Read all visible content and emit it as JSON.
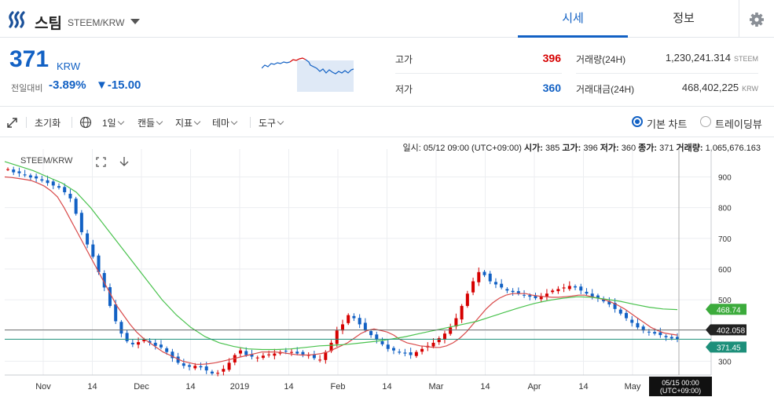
{
  "header": {
    "coin_name": "스팀",
    "coin_pair": "STEEM/KRW",
    "tabs": [
      {
        "label": "시세"
      },
      {
        "label": "정보"
      }
    ]
  },
  "summary": {
    "price": "371",
    "price_unit": "KRW",
    "change_label": "전일대비",
    "change_pct": "-3.89%",
    "change_abs": "▼-15.00",
    "high_label": "고가",
    "high_value": "396",
    "low_label": "저가",
    "low_value": "360",
    "volume_label": "거래량(24H)",
    "volume_value": "1,230,241.314",
    "volume_unit": "STEEM",
    "amount_label": "거래대금(24H)",
    "amount_value": "468,402,225",
    "amount_unit": "KRW",
    "colors": {
      "up": "#d60000",
      "down": "#1261c4"
    }
  },
  "toolbar": {
    "reset": "초기화",
    "interval": "1일",
    "candle": "캔들",
    "indicator": "지표",
    "theme": "테마",
    "tools": "도구",
    "view_basic": "기본 차트",
    "view_trading": "트레이딩뷰"
  },
  "ohlc": {
    "date_label": "일시:",
    "date_value": "05/12 09:00 (UTC+09:00)",
    "open_label": "시가:",
    "open_value": "385",
    "high_label": "고가:",
    "high_value": "396",
    "low_label": "저가:",
    "low_value": "360",
    "close_label": "종가:",
    "close_value": "371",
    "volume_label": "거래량:",
    "volume_value": "1,065,676.163"
  },
  "chart_data": {
    "type": "candlestick",
    "title": "STEEM/KRW",
    "y_ticks": [
      "300",
      "400",
      "500",
      "600",
      "700",
      "800",
      "900"
    ],
    "ylim": [
      255,
      965
    ],
    "x_ticks": [
      "Nov",
      "14",
      "Dec",
      "14",
      "2019",
      "14",
      "Feb",
      "14",
      "Mar",
      "14",
      "Apr",
      "14",
      "May"
    ],
    "crosshair_x_label": "05/15 00:00\n(UTC+09:00)",
    "crosshair_price": "402.058",
    "last_price_label": "371.45",
    "ma_label": "468.74",
    "series": [
      {
        "name": "close",
        "values": [
          925,
          915,
          912,
          905,
          898,
          895,
          888,
          880,
          872,
          865,
          850,
          830,
          780,
          720,
          680,
          640,
          590,
          540,
          480,
          430,
          390,
          365,
          355,
          362,
          370,
          360,
          350,
          345,
          330,
          310,
          295,
          285,
          282,
          285,
          280,
          270,
          260,
          262,
          275,
          295,
          320,
          335,
          320,
          315,
          312,
          318,
          322,
          325,
          330,
          332,
          330,
          325,
          322,
          320,
          310,
          305,
          330,
          360,
          400,
          420,
          450,
          440,
          420,
          400,
          385,
          370,
          355,
          340,
          335,
          328,
          325,
          320,
          330,
          340,
          350,
          360,
          375,
          390,
          410,
          440,
          480,
          520,
          560,
          590,
          580,
          560,
          550,
          540,
          530,
          525,
          520,
          515,
          510,
          505,
          510,
          520,
          530,
          535,
          540,
          545,
          540,
          530,
          520,
          510,
          505,
          495,
          485,
          470,
          455,
          440,
          425,
          410,
          400,
          395,
          390,
          385,
          378,
          374,
          371
        ]
      },
      {
        "name": "ma_short",
        "values": [
          900,
          898,
          895,
          892,
          888,
          880,
          870,
          855,
          835,
          800,
          760,
          720,
          680,
          640,
          600,
          560,
          520,
          480,
          450,
          420,
          395,
          375,
          360,
          345,
          330,
          320,
          310,
          300,
          295,
          290,
          290,
          292,
          295,
          300,
          305,
          310,
          315,
          320,
          325,
          330,
          330,
          330,
          328,
          325,
          322,
          320,
          320,
          322,
          325,
          330,
          340,
          350,
          360,
          375,
          390,
          400,
          405,
          400,
          395,
          385,
          370,
          360,
          355,
          350,
          348,
          345,
          345,
          350,
          360,
          375,
          395,
          420,
          445,
          470,
          490,
          505,
          515,
          520,
          520,
          520,
          515,
          512,
          510,
          508,
          508,
          510,
          512,
          515,
          515,
          510,
          505,
          500,
          492,
          482,
          470,
          455,
          440,
          425,
          410,
          400,
          392,
          388,
          385
        ]
      },
      {
        "name": "ma_long",
        "values": [
          950,
          935,
          920,
          900,
          880,
          850,
          800,
          740,
          680,
          620,
          560,
          500,
          450,
          410,
          380,
          360,
          348,
          340,
          338,
          338,
          340,
          345,
          350,
          352,
          355,
          360,
          365,
          372,
          380,
          390,
          400,
          410,
          420,
          430,
          445,
          460,
          475,
          488,
          498,
          505,
          510,
          508,
          502,
          495,
          485,
          476,
          470,
          468
        ]
      }
    ]
  }
}
